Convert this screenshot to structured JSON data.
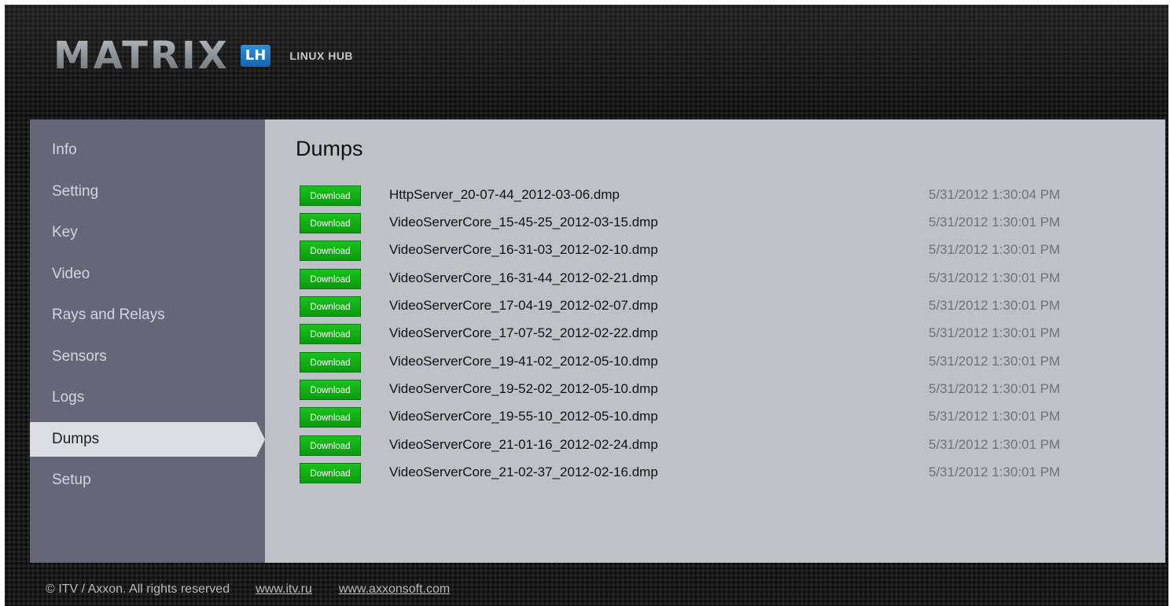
{
  "header": {
    "logo_word": "MATRIX",
    "logo_badge": "LH",
    "logo_subtitle": "LINUX HUB"
  },
  "sidebar": {
    "items": [
      {
        "label": "Info",
        "active": false
      },
      {
        "label": "Setting",
        "active": false
      },
      {
        "label": "Key",
        "active": false
      },
      {
        "label": "Video",
        "active": false
      },
      {
        "label": "Rays and Relays",
        "active": false
      },
      {
        "label": "Sensors",
        "active": false
      },
      {
        "label": "Logs",
        "active": false
      },
      {
        "label": "Dumps",
        "active": true
      },
      {
        "label": "Setup",
        "active": false
      }
    ]
  },
  "main": {
    "title": "Dumps",
    "download_label": "Download",
    "files": [
      {
        "name": "HttpServer_20-07-44_2012-03-06.dmp",
        "date": "5/31/2012 1:30:04 PM"
      },
      {
        "name": "VideoServerCore_15-45-25_2012-03-15.dmp",
        "date": "5/31/2012 1:30:01 PM"
      },
      {
        "name": "VideoServerCore_16-31-03_2012-02-10.dmp",
        "date": "5/31/2012 1:30:01 PM"
      },
      {
        "name": "VideoServerCore_16-31-44_2012-02-21.dmp",
        "date": "5/31/2012 1:30:01 PM"
      },
      {
        "name": "VideoServerCore_17-04-19_2012-02-07.dmp",
        "date": "5/31/2012 1:30:01 PM"
      },
      {
        "name": "VideoServerCore_17-07-52_2012-02-22.dmp",
        "date": "5/31/2012 1:30:01 PM"
      },
      {
        "name": "VideoServerCore_19-41-02_2012-05-10.dmp",
        "date": "5/31/2012 1:30:01 PM"
      },
      {
        "name": "VideoServerCore_19-52-02_2012-05-10.dmp",
        "date": "5/31/2012 1:30:01 PM"
      },
      {
        "name": "VideoServerCore_19-55-10_2012-05-10.dmp",
        "date": "5/31/2012 1:30:01 PM"
      },
      {
        "name": "VideoServerCore_21-01-16_2012-02-24.dmp",
        "date": "5/31/2012 1:30:01 PM"
      },
      {
        "name": "VideoServerCore_21-02-37_2012-02-16.dmp",
        "date": "5/31/2012 1:30:01 PM"
      }
    ]
  },
  "footer": {
    "copyright": "© ITV / Axxon. All rights reserved",
    "link1": "www.itv.ru",
    "link2": "www.axxonsoft.com"
  },
  "colors": {
    "sidebar_bg": "#656778",
    "main_bg": "#bfc1c8",
    "download_green": "#12b314",
    "badge_blue": "#1f7bc8"
  }
}
